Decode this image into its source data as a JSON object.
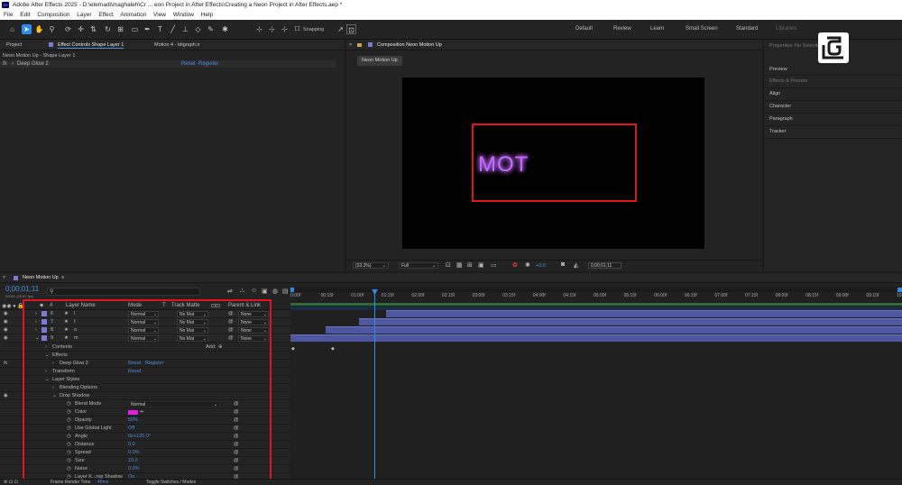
{
  "window": {
    "title": "Adobe After Effects 2025 - D:\\etemadi\\maghaleh\\Cr ... eon Project in After Effects\\Creating a Neon Project in After Effects.aep *",
    "logo": "Ae"
  },
  "menu": [
    "File",
    "Edit",
    "Composition",
    "Layer",
    "Effect",
    "Animation",
    "View",
    "Window",
    "Help"
  ],
  "toolbar": {
    "snapping_label": "Snapping",
    "workspaces": [
      "Default",
      "Review",
      "Learn",
      "Small Screen",
      "Standard",
      "Libraries"
    ]
  },
  "left_panel": {
    "tabs": [
      "Project",
      "Effect Controls Shape Layer 1",
      "Motion 4 - bitgraph.ir"
    ],
    "breadcrumb": "Neon Motion Up - Shape Layer 1",
    "effect": {
      "fx": "fx",
      "name": "Deep Glow 2",
      "reset": "Reset",
      "register": "Register"
    }
  },
  "composition": {
    "tab_label": "Composition Neon Motion Up",
    "sub_tab": "Neon Motion Up",
    "neon_text": "MOT",
    "zoom": "(33.3%)",
    "quality": "Full",
    "exposure": "+0.0",
    "timecode": "0;00;01;11"
  },
  "right_panel": {
    "items": [
      "Properties: No Selection",
      "Preview",
      "Effects & Presets",
      "Align",
      "Character",
      "Paragraph",
      "Tracker"
    ]
  },
  "timeline": {
    "comp_name": "Neon Motion Up",
    "timecode": "0;00;01;11",
    "frames": "00041 (29.97 fps)",
    "search_placeholder": "",
    "headers": {
      "num": "#",
      "layer_name": "Layer Name",
      "mode": "Mode",
      "t": "T",
      "track_matte": "Track Matte",
      "parent": "Parent & Link"
    },
    "layers": [
      {
        "num": "6",
        "name": "I",
        "mode": "Normal",
        "matte": "No Mat",
        "parent": "None"
      },
      {
        "num": "7",
        "name": "t",
        "mode": "Normal",
        "matte": "No Mat",
        "parent": "None"
      },
      {
        "num": "8",
        "name": "o",
        "mode": "Normal",
        "matte": "No Mat",
        "parent": "None"
      },
      {
        "num": "9",
        "name": "m",
        "mode": "Normal",
        "matte": "No Mat",
        "parent": "None"
      }
    ],
    "properties": {
      "contents": "Contents",
      "add": "Add:",
      "effects": "Effects",
      "deep_glow": "Deep Glow 2",
      "reset": "Reset",
      "register": "Register",
      "transform": "Transform",
      "transform_reset": "Reset",
      "layer_styles": "Layer Styles",
      "blending": "Blending Options",
      "drop_shadow": "Drop Shadow",
      "rows": [
        {
          "label": "Blend Mode",
          "value": "Normal"
        },
        {
          "label": "Color",
          "value": ""
        },
        {
          "label": "Opacity",
          "value": "50%"
        },
        {
          "label": "Use Global Light",
          "value": "Off"
        },
        {
          "label": "Angle",
          "value": "0x+120.0°"
        },
        {
          "label": "Distance",
          "value": "0.0"
        },
        {
          "label": "Spread",
          "value": "0.0%"
        },
        {
          "label": "Size",
          "value": "10.0"
        },
        {
          "label": "Noise",
          "value": "0.0%"
        },
        {
          "label": "Layer K...rop Shadow",
          "value": "On"
        }
      ]
    },
    "ruler": [
      "0:00f",
      "00:15f",
      "01:00f",
      "01:15f",
      "02:00f",
      "02:15f",
      "03:00f",
      "03:15f",
      "04:00f",
      "04:15f",
      "05:00f",
      "05:15f",
      "06:00f",
      "06:15f",
      "07:00f",
      "07:15f",
      "08:00f",
      "08:15f",
      "09:00f",
      "09:15f",
      "10:0"
    ],
    "footer": {
      "render_label": "Frame Render Time",
      "render_value": "40ms",
      "toggle": "Toggle Switches / Modes"
    },
    "colors": {
      "label_purple": "#7a7ad6",
      "bar": "#4d579f",
      "shadow_color": "#e020e0"
    }
  }
}
